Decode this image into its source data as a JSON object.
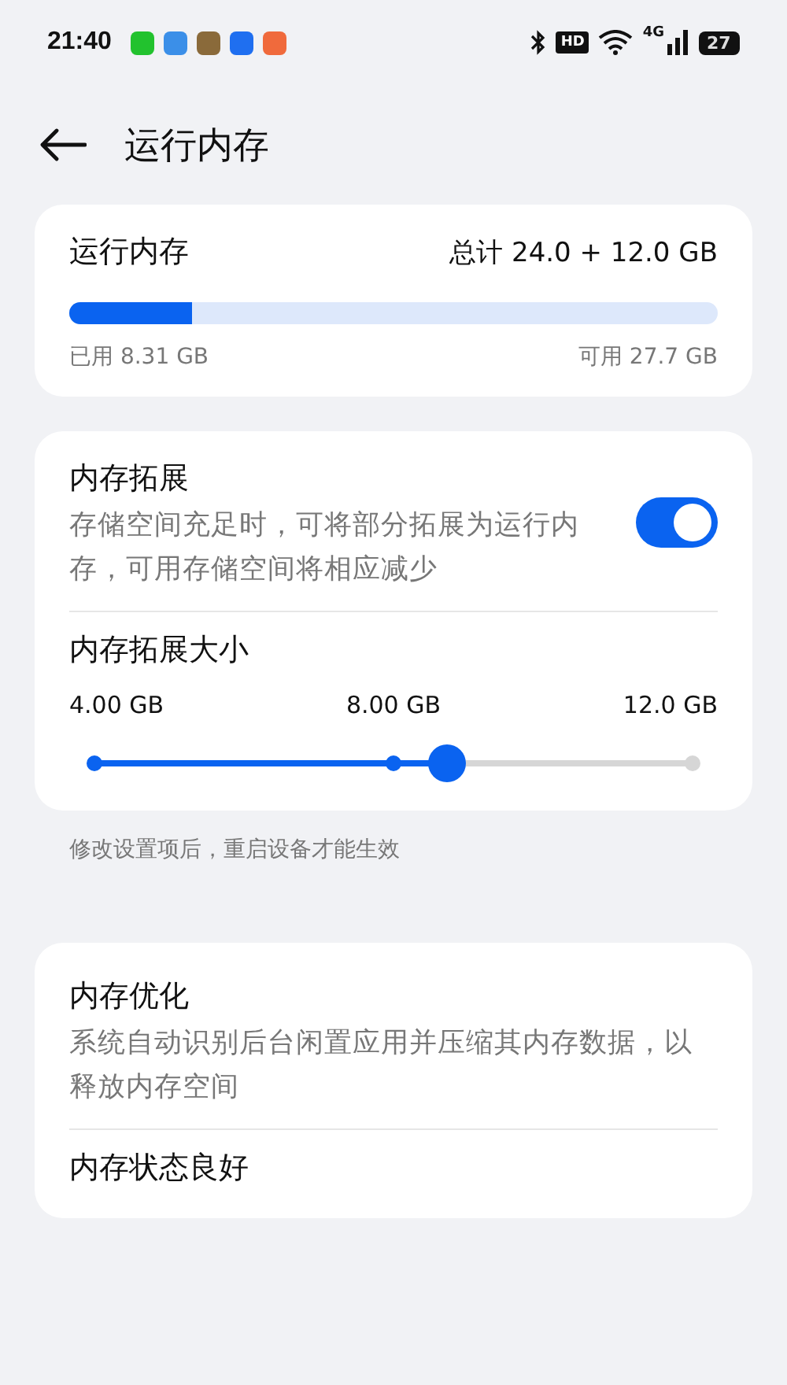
{
  "status_bar": {
    "time": "21:40",
    "app_icons": [
      {
        "color": "#22c22e"
      },
      {
        "color": "#3b8fe8"
      },
      {
        "color": "#8a6a3a"
      },
      {
        "color": "#1f6ff0"
      },
      {
        "color": "#f06a3c"
      }
    ],
    "hd": "HD",
    "network": "4G",
    "battery": "27"
  },
  "header": {
    "title": "运行内存"
  },
  "ram_card": {
    "title": "运行内存",
    "total": "总计 24.0 + 12.0 GB",
    "level": 0.19,
    "used": "已用 8.31 GB",
    "available": "可用 27.7 GB"
  },
  "extension_card": {
    "title": "内存拓展",
    "description": "存储空间充足时，可将部分拓展为运行内存，可用存储空间将相应减少",
    "on": true,
    "size_title": "内存拓展大小",
    "ticks": [
      "4.00 GB",
      "8.00 GB",
      "12.0 GB"
    ],
    "level": 0.59
  },
  "note": "修改设置项后，重启设备才能生效",
  "optimize_card": {
    "title": "内存优化",
    "description": "系统自动识别后台闲置应用并压缩其内存数据，以释放内存空间",
    "status": "内存状态良好"
  }
}
